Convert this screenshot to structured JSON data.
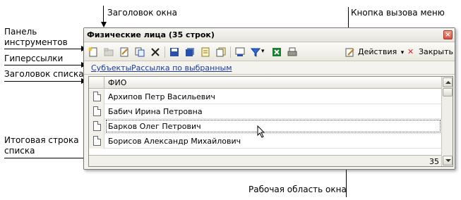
{
  "annotations": {
    "window_title": "Заголовок окна",
    "menu_button": "Кнопка вызова меню",
    "toolbar_line1": "Панель",
    "toolbar_line2": "инструментов",
    "hyperlinks": "Гиперссылки",
    "list_header": "Заголовок списка",
    "total_line1": "Итоговая строка",
    "total_line2": "списка",
    "work_area": "Рабочая область окна"
  },
  "window": {
    "title": "Физические лица (35 строк)",
    "close_glyph": "×"
  },
  "toolbar": {
    "actions_label": "Действия",
    "actions_dropdown_glyph": "▾",
    "close_label": "Закрыть",
    "close_glyph": "✕"
  },
  "links": {
    "subjects": "Субъекты",
    "mailing": "Рассылка по выбранным"
  },
  "grid": {
    "header": "ФИО",
    "rows": [
      "Архипов Петр Васильевич",
      "Бабич Ирина Петровна",
      "Барков Олег Петрович",
      "Борисов Александр Михайлович"
    ],
    "total": "35"
  },
  "colors": {
    "link": "#1d3b9e",
    "close_button": "#d9533f",
    "excel_icon": "#1e7d32",
    "save_icon": "#2a4fa8"
  }
}
